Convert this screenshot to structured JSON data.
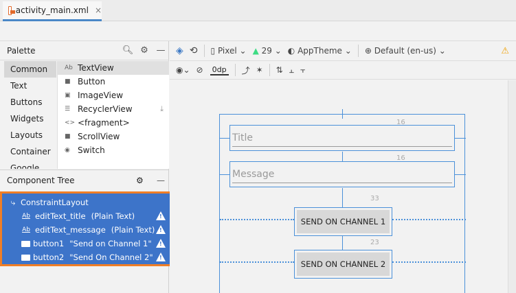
{
  "editor_tab": {
    "label": "activity_main.xml",
    "close": "×"
  },
  "palette": {
    "title": "Palette",
    "categories": [
      "Common",
      "Text",
      "Buttons",
      "Widgets",
      "Layouts",
      "Container",
      "Google"
    ],
    "selected_category": "Common",
    "items": [
      {
        "icon_text": "Ab",
        "label": "TextView"
      },
      {
        "icon_text": "■",
        "label": "Button"
      },
      {
        "icon_text": "▣",
        "label": "ImageView"
      },
      {
        "icon_text": "☰",
        "label": "RecyclerView"
      },
      {
        "icon_text": "<>",
        "label": "<fragment>"
      },
      {
        "icon_text": "■",
        "label": "ScrollView"
      },
      {
        "icon_text": "◉",
        "label": "Switch"
      }
    ]
  },
  "component_tree": {
    "title": "Component Tree",
    "root": "ConstraintLayout",
    "nodes": [
      {
        "icon_text": "Ab",
        "id": "editText_title",
        "extra": "(Plain Text)"
      },
      {
        "icon_text": "Ab",
        "id": "editText_message",
        "extra": "(Plain Text)"
      },
      {
        "icon_text": "",
        "id": "button1",
        "extra": "\"Send on Channel 1\""
      },
      {
        "icon_text": "",
        "id": "button2",
        "extra": "\"Send On Channel 2\""
      }
    ]
  },
  "design_toolbar": {
    "device": "Pixel",
    "api_level": "29",
    "theme": "AppTheme",
    "locale": "Default (en-us)",
    "margin": "0dp"
  },
  "preview": {
    "title_hint": "Title",
    "message_hint": "Message",
    "button1_label": "SEND ON CHANNEL 1",
    "button2_label": "SEND ON CHANNEL 2",
    "margin_title": "16",
    "margin_message": "16",
    "margin_button1": "33",
    "margin_button2": "23"
  },
  "colors": {
    "selection": "#3d74c9",
    "highlight_border": "#f07e26",
    "blueprint": "#4a90d9",
    "warning": "#f0a30a"
  }
}
